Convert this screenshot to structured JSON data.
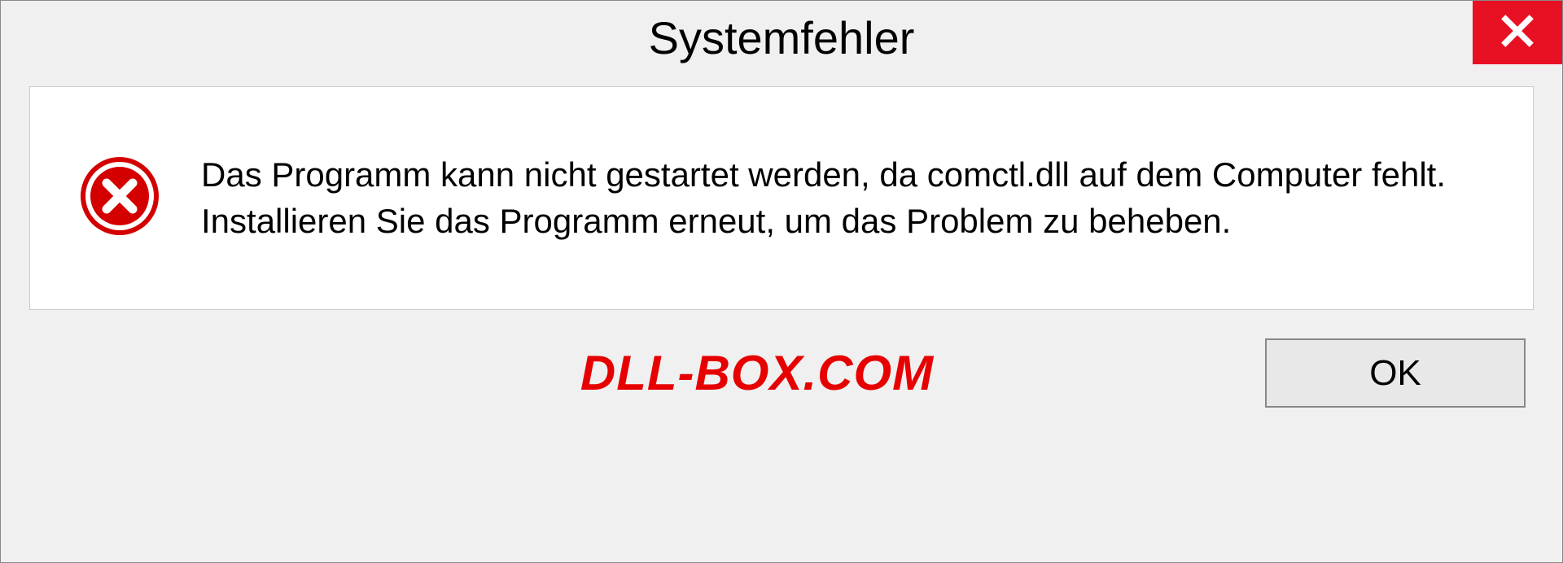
{
  "dialog": {
    "title": "Systemfehler",
    "message": "Das Programm kann nicht gestartet werden, da comctl.dll auf dem Computer fehlt. Installieren Sie das Programm erneut, um das Problem zu beheben.",
    "ok_label": "OK"
  },
  "watermark": "DLL-BOX.COM"
}
